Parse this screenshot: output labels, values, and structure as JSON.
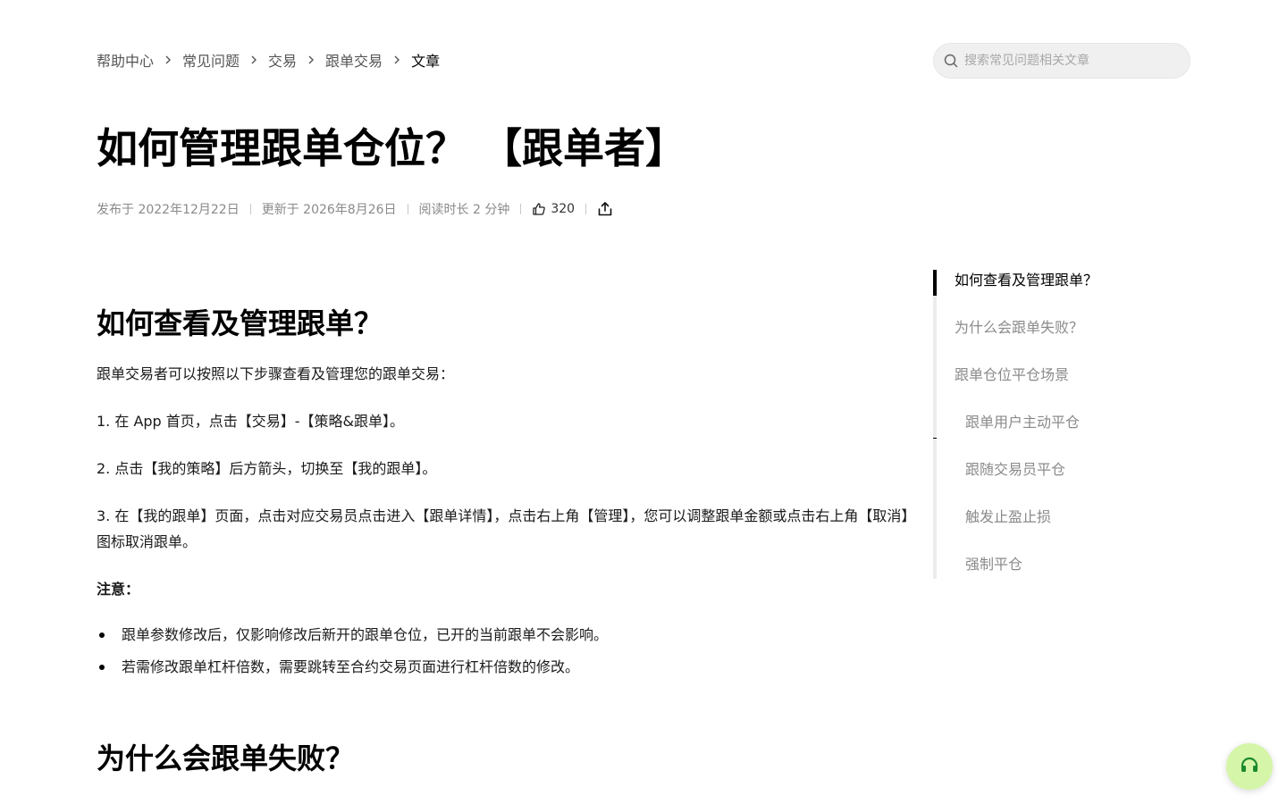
{
  "breadcrumb": {
    "items": [
      "帮助中心",
      "常见问题",
      "交易",
      "跟单交易"
    ],
    "current": "文章"
  },
  "search": {
    "placeholder": "搜索常见问题相关文章"
  },
  "article": {
    "title": "如何管理跟单仓位？ 【跟单者】",
    "meta": {
      "published": "发布于 2022年12月22日",
      "updated": "更新于 2026年8月26日",
      "read_time": "阅读时长 2 分钟",
      "likes": "320"
    },
    "sections": [
      {
        "heading": "如何查看及管理跟单？",
        "intro": "跟单交易者可以按照以下步骤查看及管理您的跟单交易：",
        "steps": [
          "1. 在 App 首页，点击【交易】-【策略&跟单】。",
          "2. 点击【我的策略】后方箭头，切换至【我的跟单】。",
          "3. 在【我的跟单】页面，点击对应交易员点击进入【跟单详情】，点击右上角【管理】，您可以调整跟单金额或点击右上角【取消】图标取消跟单。"
        ],
        "note_label": "注意：",
        "notes": [
          "跟单参数修改后，仅影响修改后新开的跟单仓位，已开的当前跟单不会影响。",
          "若需修改跟单杠杆倍数，需要跳转至合约交易页面进行杠杆倍数的修改。"
        ]
      },
      {
        "heading": "为什么会跟单失败？"
      }
    ]
  },
  "toc": {
    "items": [
      {
        "label": "如何查看及管理跟单？",
        "active": true
      },
      {
        "label": "为什么会跟单失败？"
      },
      {
        "label": "跟单仓位平仓场景"
      },
      {
        "label": "跟单用户主动平仓",
        "sub": true
      },
      {
        "label": "跟随交易员平仓",
        "sub": true
      },
      {
        "label": "触发止盈止损",
        "sub": true
      },
      {
        "label": "强制平仓",
        "sub": true
      }
    ]
  },
  "colors": {
    "accent_fab": "#d5f5a8",
    "fab_icon": "#1b8a2e",
    "muted_text": "#8a8a8a"
  },
  "icons": {
    "search": "search-icon",
    "chevron": "chevron-right-icon",
    "like": "thumbs-up-icon",
    "share": "share-icon",
    "support": "headset-icon"
  }
}
